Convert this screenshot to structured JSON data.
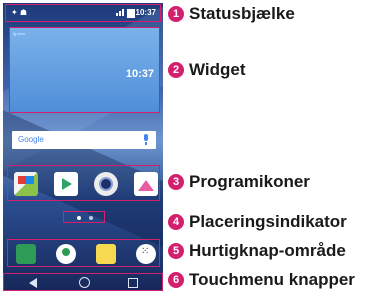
{
  "phone": {
    "status_time": "10:37",
    "widget_time": "10:37",
    "widget_source": "lg.com",
    "search_label": "Google",
    "dock_label": "Hurtigknap-område"
  },
  "callouts": [
    {
      "number": "1",
      "text": "Statusbjælke"
    },
    {
      "number": "2",
      "text": "Widget"
    },
    {
      "number": "3",
      "text": "Programikoner"
    },
    {
      "number": "4",
      "text": "Placeringsindikator"
    },
    {
      "number": "5",
      "text": "Hurtigknap-område"
    },
    {
      "number": "6",
      "text": "Touchmenu knapper"
    }
  ],
  "colors": {
    "accent": "#d21f6e"
  },
  "icons": {
    "apps": [
      "play-store-icon",
      "play-icon",
      "camera-icon",
      "gallery-icon"
    ],
    "dock": [
      "phone-icon",
      "contacts-icon",
      "messages-icon",
      "apps-icon"
    ],
    "nav": [
      "back-icon",
      "home-icon",
      "recent-apps-icon"
    ]
  }
}
